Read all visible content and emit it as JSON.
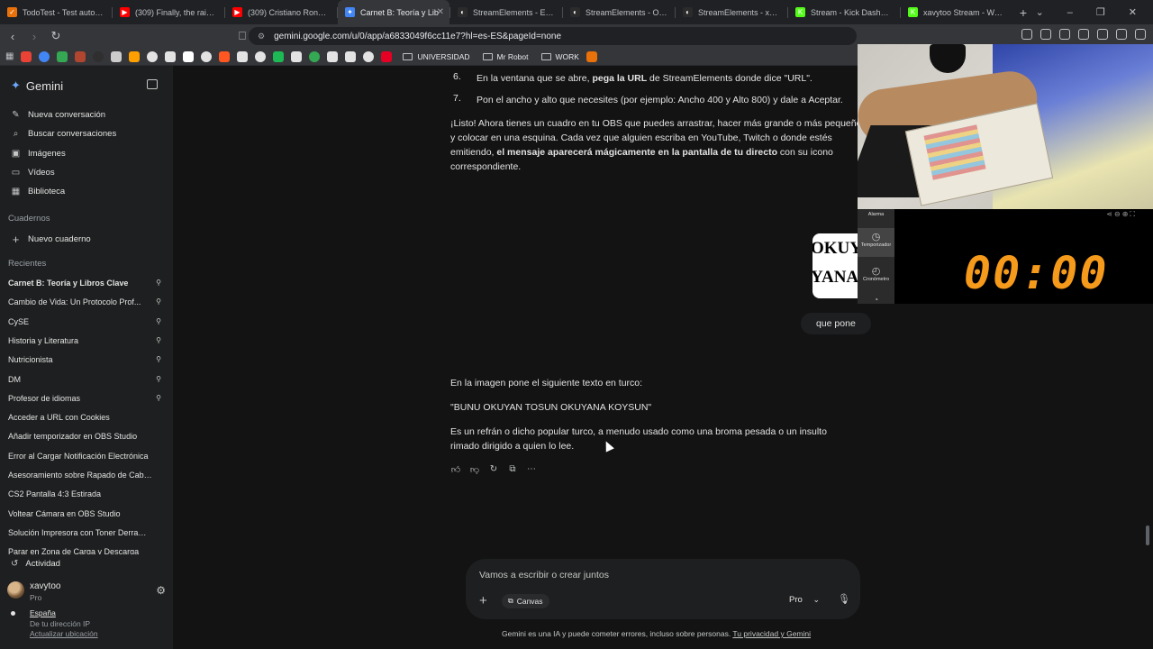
{
  "browser": {
    "tabs": [
      {
        "label": "TodoTest - Test autoescue",
        "icon_color": "#e8710a",
        "icon": "✓"
      },
      {
        "label": "(309) Finally, the rain... a l",
        "icon_color": "#ff0000",
        "icon": "▶"
      },
      {
        "label": "(309) Cristiano Ronaldo sp",
        "icon_color": "#ff0000",
        "icon": "▶"
      },
      {
        "label": "Carnet B: Teoría y Lib",
        "icon_color": "#4285f4",
        "icon": "✦"
      },
      {
        "label": "StreamElements - Elemen",
        "icon_color": "#2b2b2b",
        "icon": "◐"
      },
      {
        "label": "StreamElements - Overlay",
        "icon_color": "#2b2b2b",
        "icon": "◐"
      },
      {
        "label": "StreamElements - xavytoo",
        "icon_color": "#2b2b2b",
        "icon": "◐"
      },
      {
        "label": "Stream - Kick Dashboard",
        "icon_color": "#53fc18",
        "icon": "K"
      },
      {
        "label": "xavytoo Stream - Watch L",
        "icon_color": "#53fc18",
        "icon": "K"
      }
    ],
    "active_tab": 3,
    "url": "gemini.google.com/u/0/app/a6833049f6cc11e7?hl=es-ES&pageId=none",
    "bookmarks": {
      "folders": [
        "UNIVERSIDAD",
        "Mr Robot",
        "WORK"
      ],
      "icon_colors": [
        "#ea4335",
        "#4285f4",
        "#34a853",
        "#b0462f",
        "#2f2f2f",
        "#cccccc",
        "#ffa000",
        "#e3e3e3",
        "#e3e3e3",
        "#ffffff",
        "#e3e3e3",
        "#ff5722",
        "#e3e3e3",
        "#e3e3e3",
        "#1db954",
        "#e3e3e3",
        "#34a853",
        "#e3e3e3",
        "#e3e3e3",
        "#e3e3e3",
        "#e60023"
      ]
    }
  },
  "sidebar": {
    "brand": "Gemini",
    "nav": [
      {
        "label": "Nueva conversación",
        "icon": "edit-icon",
        "glyph": "✎"
      },
      {
        "label": "Buscar conversaciones",
        "icon": "search-icon",
        "glyph": "⌕"
      },
      {
        "label": "Imágenes",
        "icon": "image-icon",
        "glyph": "▣"
      },
      {
        "label": "Vídeos",
        "icon": "video-icon",
        "glyph": "▭"
      },
      {
        "label": "Biblioteca",
        "icon": "library-icon",
        "glyph": "▦"
      }
    ],
    "notebooks_heading": "Cuadernos",
    "new_notebook": "Nuevo cuaderno",
    "recents_heading": "Recientes",
    "recents": [
      {
        "label": "Carnet B: Teoría y Libros Clave",
        "pinned": true
      },
      {
        "label": "Cambio de Vida: Un Protocolo Prof...",
        "pinned": true
      },
      {
        "label": "CySE",
        "pinned": true
      },
      {
        "label": "Historia y Literatura",
        "pinned": true
      },
      {
        "label": "Nutricionista",
        "pinned": true
      },
      {
        "label": "DM",
        "pinned": true
      },
      {
        "label": "Profesor de idiomas",
        "pinned": true
      },
      {
        "label": "Acceder a URL con Cookies",
        "pinned": false
      },
      {
        "label": "Añadir temporizador en OBS Studio",
        "pinned": false
      },
      {
        "label": "Error al Cargar Notificación Electrónica",
        "pinned": false
      },
      {
        "label": "Asesoramiento sobre Rapado de Cabeza",
        "pinned": false
      },
      {
        "label": "CS2 Pantalla 4:3 Estirada",
        "pinned": false
      },
      {
        "label": "Voltear Cámara en OBS Studio",
        "pinned": false
      },
      {
        "label": "Solución Impresora con Toner Derrama...",
        "pinned": false
      },
      {
        "label": "Parar en Zona de Carga y Descarga",
        "pinned": false
      }
    ],
    "activity": "Actividad",
    "user": {
      "name": "xavytoo",
      "plan": "Pro"
    },
    "location": {
      "country": "España",
      "source": "De tu dirección IP",
      "update": "Actualizar ubicación"
    }
  },
  "chat": {
    "steps": [
      {
        "num": "6.",
        "pre": "En la ventana que se abre, ",
        "bold": "pega la URL",
        "post": " de StreamElements donde dice \"URL\"."
      },
      {
        "num": "7.",
        "text": "Pon el ancho y alto que necesites (por ejemplo: Ancho 400 y Alto 800) y dale a Aceptar."
      }
    ],
    "summary": {
      "pre": "¡Listo! Ahora tienes un cuadro en tu OBS que puedes arrastrar, hacer más grande o más pequeño, y colocar en una esquina. Cada vez que alguien escriba en YouTube, Twitch o donde estés emitiendo, ",
      "bold": "el mensaje aparecerá mágicamente en la pantalla de tu directo",
      "post": " con su icono correspondiente."
    },
    "user_message": "que pone",
    "answer_intro": "En la imagen pone el siguiente texto en turco:",
    "answer_quote": "\"BUNU OKUYAN TOSUN OKUYANA KOYSUN\"",
    "answer_explain": "Es un refrán o dicho popular turco, a menudo usado como una broma pesada o un insulto rimado dirigido a quien lo lee."
  },
  "composer": {
    "placeholder": "Vamos a escribir o crear juntos",
    "canvas_label": "Canvas",
    "model_label": "Pro",
    "disclaimer": "Gemini es una IA y puede cometer errores, incluso sobre personas. ",
    "disclaimer_link": "Tu privacidad y Gemini"
  },
  "overlay": {
    "sign_text_1": "OKUYA",
    "sign_text_2": "YANA",
    "timer_value": "00:00",
    "timer_color": "#f59a1b",
    "timer_menu": [
      {
        "label": "Alarma"
      },
      {
        "label": "Temporizador"
      },
      {
        "label": "Cronómetro"
      }
    ]
  }
}
